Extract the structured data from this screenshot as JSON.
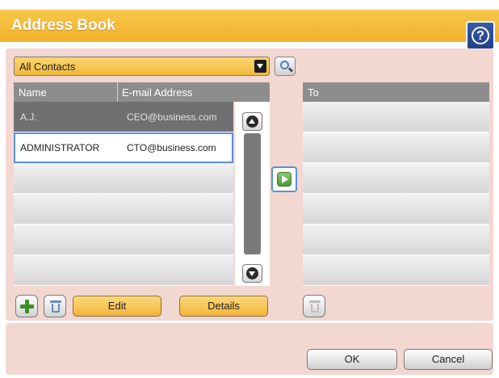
{
  "window": {
    "title": "Address Book",
    "help_symbol": "?"
  },
  "filter": {
    "selected": "All Contacts"
  },
  "contacts": {
    "columns": [
      "Name",
      "E-mail Address"
    ],
    "rows": [
      {
        "name": "A.J.",
        "email": "CEO@business.com",
        "state": "dark"
      },
      {
        "name": "ADMINISTRATOR",
        "email": "CTO@business.com",
        "state": "selected"
      },
      {
        "name": "",
        "email": "",
        "state": "empty"
      },
      {
        "name": "",
        "email": "",
        "state": "empty"
      },
      {
        "name": "",
        "email": "",
        "state": "empty"
      },
      {
        "name": "",
        "email": "",
        "state": "empty"
      }
    ]
  },
  "recipients": {
    "header": "To",
    "rows": [
      "",
      "",
      "",
      "",
      "",
      ""
    ]
  },
  "actions": {
    "edit_label": "Edit",
    "details_label": "Details"
  },
  "footer": {
    "ok_label": "OK",
    "cancel_label": "Cancel"
  },
  "icons": {
    "help": "help-icon",
    "search": "search-icon",
    "add": "plus-icon",
    "delete": "trash-icon",
    "add_to_recipients": "arrow-right-icon",
    "scroll_up": "chevron-up-icon",
    "scroll_down": "chevron-down-icon"
  },
  "colors": {
    "title_bar": "#f3b22c",
    "panel": "#f3d7d1",
    "header": "#8d8d8d",
    "selection": "#5b8fd6",
    "action_button": "#f2b43a"
  }
}
